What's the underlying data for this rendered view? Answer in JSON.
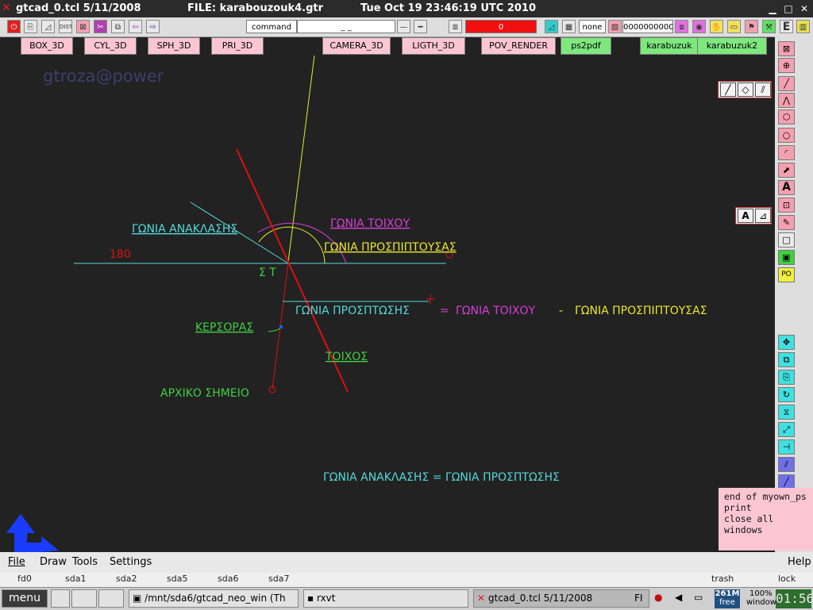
{
  "window": {
    "app_title": "gtcad_0.tcl 5/11/2008",
    "file_label": "FILE: karabouzouk4.gtr",
    "clock_title": "Tue Oct 19 23:46:19 UTC 2010"
  },
  "toolbar": {
    "command_label": "command",
    "command_value": "_ _",
    "color_value": "0",
    "none_label": "none",
    "bits_value": "0000000000"
  },
  "buttons3d": [
    {
      "label": "BOX_3D",
      "color": "#fbc6d2"
    },
    {
      "label": "CYL_3D",
      "color": "#fbc6d2"
    },
    {
      "label": "SPH_3D",
      "color": "#fbc6d2"
    },
    {
      "label": "PRI_3D",
      "color": "#fbc6d2"
    },
    {
      "label": "CAMERA_3D",
      "color": "#fbc6d2"
    },
    {
      "label": "LIGTH_3D",
      "color": "#fbc6d2"
    },
    {
      "label": "POV_RENDER",
      "color": "#fbc6d2"
    },
    {
      "label": "ps2pdf",
      "color": "#7ee87e"
    },
    {
      "label": "karabuzuk",
      "color": "#7ee87e"
    },
    {
      "label": "karabuzuk2",
      "color": "#7ee87e"
    }
  ],
  "watermark": "gtroza@power",
  "canvas_labels": {
    "angle_wall": "ΓΩΝΙΑ ΤΟΙΧΟΥ",
    "angle_reflection": "ΓΩΝΙΑ ΑΝΑΚΛΑΣΗΣ",
    "angle_incident": "ΓΩΝΙΑ ΠΡΟΣΠΙΠΤΟΥΣΑΣ",
    "number_180": "180",
    "st_label": "Σ Τ",
    "angle_incidence": "ΓΩΝΙΑ ΠΡΟΣΠΤΩΣΗΣ",
    "equals": "=",
    "minus": "-",
    "cursor": "ΚΕΡΣΟΡΑΣ",
    "wall": "ΤΟΙΧΟΣ",
    "start_point": "ΑΡΧΙΚΟ ΣΗΜΕΙΟ",
    "reflection_eq": "ΓΩΝΙΑ ΑΝΑΚΛΑΣΗΣ = ΓΩΝΙΑ ΠΡΟΣΠΤΩΣΗΣ"
  },
  "colors": {
    "cyan": "#55d8d8",
    "magenta": "#d640d6",
    "yellow": "#e8e830",
    "green": "#40d040",
    "red": "#e01010",
    "canvas": "#222222"
  },
  "pink_panel": [
    "end of myown_ps",
    "print",
    "close all",
    "windows"
  ],
  "menu": {
    "file": "File",
    "draw": "Draw",
    "tools": "Tools",
    "settings": "Settings",
    "help": "Help"
  },
  "desktop_labels": [
    "fd0",
    "sda1",
    "sda2",
    "sda5",
    "sda6",
    "sda7",
    "trash",
    "lock"
  ],
  "taskbar": {
    "menu": "menu",
    "task1": "/mnt/sda6/gtcad_neo_win (Th",
    "task2": "rxvt",
    "task3": "gtcad_0.tcl 5/11/2008",
    "task3_suffix": "FI",
    "mem": "261M",
    "mem_sub": "free",
    "battery": "100%",
    "windows": "windows",
    "clock": "01:56"
  }
}
